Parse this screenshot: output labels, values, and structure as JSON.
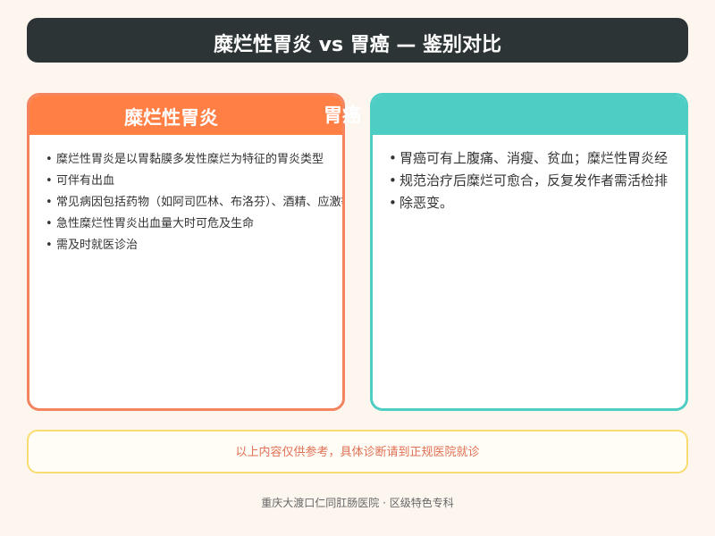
{
  "header": {
    "title": "糜烂性胃炎 vs 胃癌 — 鉴别对比"
  },
  "panels": {
    "left": {
      "title": "糜烂性胃炎",
      "accent": "#ff7f45",
      "items": [
        "糜烂性胃炎是以胃黏膜多发性糜烂为特征的胃炎类型",
        "可伴有出血",
        "常见病因包括药物（如阿司匹林、布洛芬）、酒精、应激等",
        "急性糜烂性胃炎出血量大时可危及生命",
        "需及时就医诊治"
      ]
    },
    "right": {
      "title": "胃癌",
      "accent": "#4ecdc4",
      "items": [
        "胃癌可有上腹痛、消瘦、贫血；糜烂性胃炎经",
        "规范治疗后糜烂可愈合，反复发作者需活检排",
        "除恶变。"
      ]
    }
  },
  "notice": {
    "text": "以上内容仅供参考，具体诊断请到正规医院就诊"
  },
  "footer": {
    "text": "重庆大渡口仁同肛肠医院 · 区级特色专科"
  },
  "bullet_glyph": "•"
}
